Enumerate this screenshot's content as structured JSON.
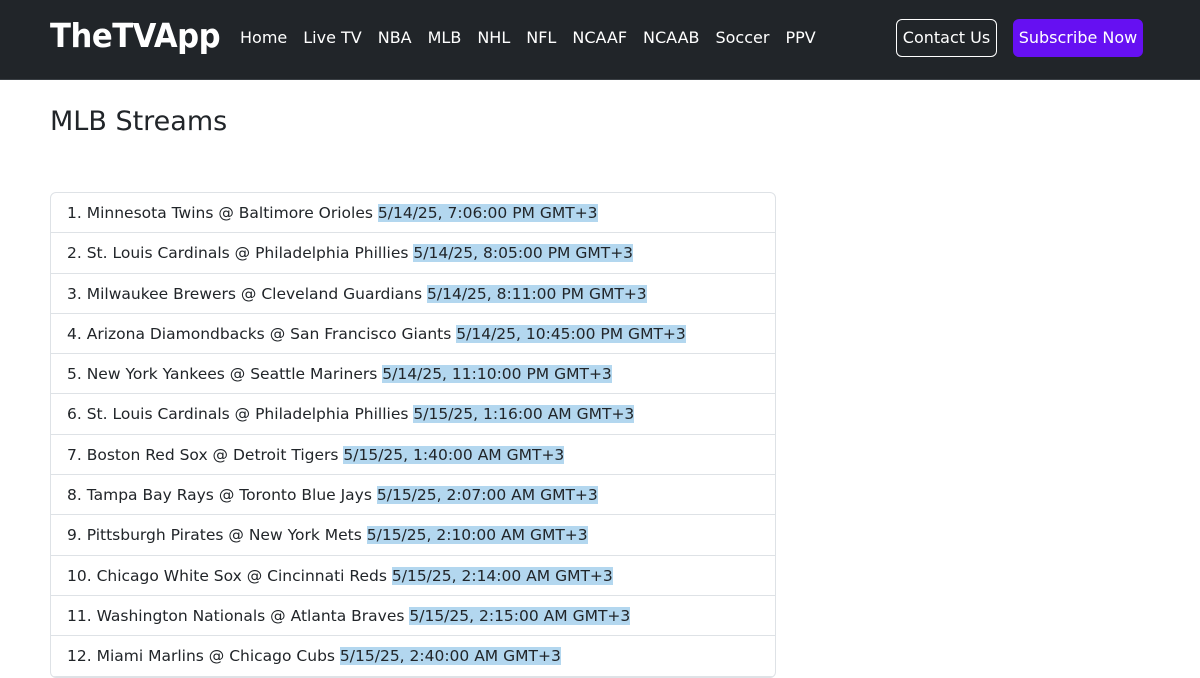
{
  "header": {
    "brand": "TheTVApp",
    "nav": [
      "Home",
      "Live TV",
      "NBA",
      "MLB",
      "NHL",
      "NFL",
      "NCAAF",
      "NCAAB",
      "Soccer",
      "PPV"
    ],
    "contact_label": "Contact Us",
    "subscribe_label": "Subscribe Now",
    "subscribe_color": "#6610f2",
    "bar_color": "#212529"
  },
  "main": {
    "title": "MLB Streams",
    "games": [
      {
        "matchup": "1. Minnesota Twins @ Baltimore Orioles",
        "time": "5/14/25, 7:06:00 PM GMT+3"
      },
      {
        "matchup": "2. St. Louis Cardinals @ Philadelphia Phillies",
        "time": "5/14/25, 8:05:00 PM GMT+3"
      },
      {
        "matchup": "3. Milwaukee Brewers @ Cleveland Guardians",
        "time": "5/14/25, 8:11:00 PM GMT+3"
      },
      {
        "matchup": "4. Arizona Diamondbacks @ San Francisco Giants",
        "time": "5/14/25, 10:45:00 PM GMT+3"
      },
      {
        "matchup": "5. New York Yankees @ Seattle Mariners",
        "time": "5/14/25, 11:10:00 PM GMT+3"
      },
      {
        "matchup": "6. St. Louis Cardinals @ Philadelphia Phillies",
        "time": "5/15/25, 1:16:00 AM GMT+3"
      },
      {
        "matchup": "7. Boston Red Sox @ Detroit Tigers",
        "time": "5/15/25, 1:40:00 AM GMT+3"
      },
      {
        "matchup": "8. Tampa Bay Rays @ Toronto Blue Jays",
        "time": "5/15/25, 2:07:00 AM GMT+3"
      },
      {
        "matchup": "9. Pittsburgh Pirates @ New York Mets",
        "time": "5/15/25, 2:10:00 AM GMT+3"
      },
      {
        "matchup": "10. Chicago White Sox @ Cincinnati Reds",
        "time": "5/15/25, 2:14:00 AM GMT+3"
      },
      {
        "matchup": "11. Washington Nationals @ Atlanta Braves",
        "time": "5/15/25, 2:15:00 AM GMT+3"
      },
      {
        "matchup": "12. Miami Marlins @ Chicago Cubs",
        "time": "5/15/25, 2:40:00 AM GMT+3"
      }
    ],
    "time_highlight_color": "#b3d7ef"
  }
}
